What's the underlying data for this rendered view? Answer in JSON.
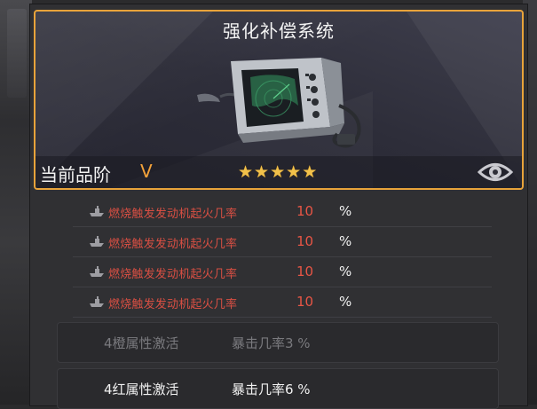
{
  "header": {
    "title": "强化补偿系统",
    "grade_label": "当前品阶",
    "grade_value": "V",
    "stars": 5,
    "item_icon": "radar-display-icon",
    "view_icon": "eye-icon"
  },
  "stats": [
    {
      "icon": "ship-icon",
      "name": "燃烧触发发动机起火几率",
      "value": "10",
      "unit": "%"
    },
    {
      "icon": "ship-icon",
      "name": "燃烧触发发动机起火几率",
      "value": "10",
      "unit": "%"
    },
    {
      "icon": "ship-icon",
      "name": "燃烧触发发动机起火几率",
      "value": "10",
      "unit": "%"
    },
    {
      "icon": "ship-icon",
      "name": "燃烧触发发动机起火几率",
      "value": "10",
      "unit": "%"
    }
  ],
  "bonuses": [
    {
      "name": "4橙属性激活",
      "effect": "暴击几率3 %",
      "state": "inactive"
    },
    {
      "name": "4红属性激活",
      "effect": "暴击几率6 %",
      "state": "active"
    }
  ],
  "colors": {
    "accent_border": "#e8a33a",
    "grade": "#f3a23a",
    "star": "#f2c14a",
    "stat_text": "#d94f43",
    "stat_value": "#e85545"
  }
}
